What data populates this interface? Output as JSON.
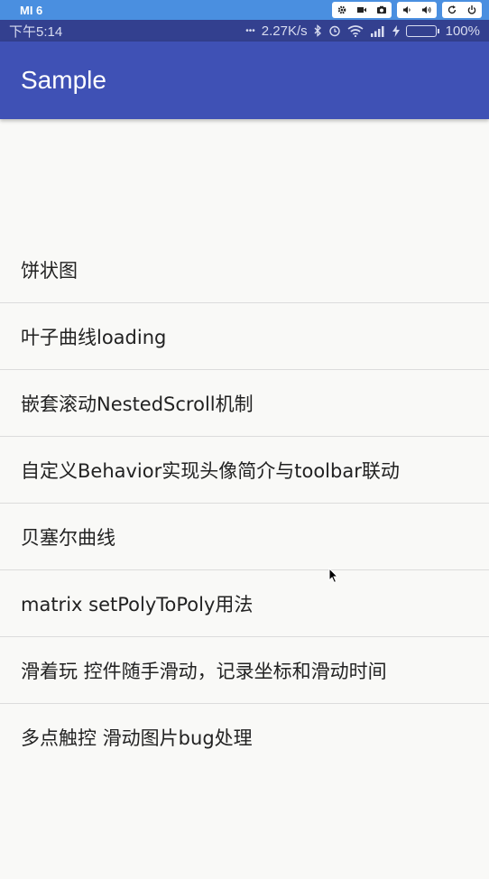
{
  "emulator": {
    "device_name": "MI 6",
    "controls": [
      {
        "name": "settings-icon"
      },
      {
        "name": "video-icon"
      },
      {
        "name": "camera-icon"
      },
      {
        "name": "volume-down-icon"
      },
      {
        "name": "volume-up-icon"
      },
      {
        "name": "rotate-icon"
      },
      {
        "name": "power-icon"
      }
    ]
  },
  "status_bar": {
    "time": "下午5:14",
    "dots": "•••",
    "net_speed": "2.27K/s",
    "battery_percent": "100%",
    "battery_level": 1.0,
    "icons": [
      "bluetooth-icon",
      "alarm-icon",
      "wifi-icon",
      "signal-icon",
      "charging-icon"
    ]
  },
  "app_bar": {
    "title": "Sample",
    "color": "#3f51b5"
  },
  "menu": {
    "items": [
      {
        "label": "饼状图"
      },
      {
        "label": "叶子曲线loading"
      },
      {
        "label": "嵌套滚动NestedScroll机制"
      },
      {
        "label": "自定义Behavior实现头像简介与toolbar联动"
      },
      {
        "label": "贝塞尔曲线"
      },
      {
        "label": "matrix setPolyToPoly用法"
      },
      {
        "label": "滑着玩 控件随手滑动，记录坐标和滑动时间"
      },
      {
        "label": "多点触控 滑动图片bug处理"
      }
    ]
  }
}
